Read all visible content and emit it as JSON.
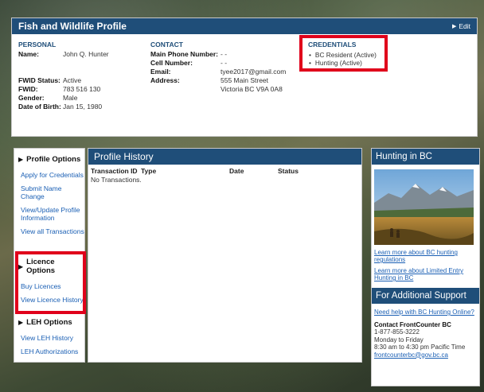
{
  "profile": {
    "title": "Fish and Wildlife Profile",
    "edit_label": "Edit",
    "personal": {
      "heading": "PERSONAL",
      "name_label": "Name:",
      "name_value": "John Q. Hunter",
      "fwid_status_label": "FWID Status:",
      "fwid_status_value": "Active",
      "fwid_label": "FWID:",
      "fwid_value": "783 516 130",
      "gender_label": "Gender:",
      "gender_value": "Male",
      "dob_label": "Date of Birth:",
      "dob_value": "Jan 15, 1980"
    },
    "contact": {
      "heading": "CONTACT",
      "main_phone_label": "Main Phone Number:",
      "main_phone_value": "- -",
      "cell_label": "Cell Number:",
      "cell_value": "- -",
      "email_label": "Email:",
      "email_value": "tyee2017@gmail.com",
      "address_label": "Address:",
      "address_line1": "555 Main Street",
      "address_line2": "Victoria BC V9A 0A8"
    },
    "credentials": {
      "heading": "CREDENTIALS",
      "items": [
        "BC Resident (Active)",
        "Hunting (Active)"
      ]
    }
  },
  "sidebar": {
    "profile_options": {
      "heading": "Profile Options",
      "links": [
        "Apply for Credentials",
        "Submit Name Change",
        "View/Update Profile Information",
        "View all Transactions"
      ]
    },
    "licence_options": {
      "heading": "Licence Options",
      "links": [
        "Buy Licences",
        "View Licence History"
      ]
    },
    "leh_options": {
      "heading": "LEH Options",
      "links": [
        "View LEH History",
        "LEH Authorizations"
      ]
    }
  },
  "history": {
    "title": "Profile History",
    "columns": [
      "Transaction ID",
      "Type",
      "Date",
      "Status"
    ],
    "empty_text": "No Transactions."
  },
  "hunting": {
    "title": "Hunting in BC",
    "links": [
      "Learn more about BC hunting regulations",
      "Learn more about Limited Entry Hunting in BC"
    ]
  },
  "support": {
    "title": "For Additional Support",
    "help_link": "Need help with BC Hunting Online?",
    "contact_title": "Contact FrontCounter BC",
    "phone": "1-877-855-3222",
    "days": "Monday to Friday",
    "hours": "8:30 am to 4:30 pm Pacific Time",
    "email": "frontcounterbc@gov.bc.ca"
  },
  "colors": {
    "header_blue": "#1f4e79",
    "link_blue": "#1a5fb4",
    "highlight_red": "#e0001b"
  }
}
